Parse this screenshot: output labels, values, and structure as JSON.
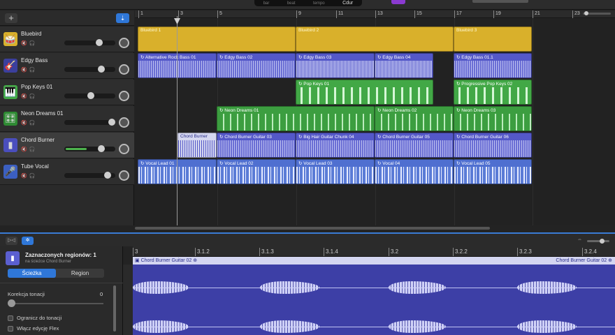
{
  "toolbar": {
    "lcd_items": [
      "bar",
      "beat",
      "tempo",
      "Cdur"
    ]
  },
  "tracks_header": {
    "add_label": "+",
    "smart_icon": "filter-icon"
  },
  "ruler": {
    "bars": [
      "1",
      "3",
      "5",
      "9",
      "11",
      "13",
      "15",
      "17",
      "19",
      "21",
      "23"
    ]
  },
  "tracks": [
    {
      "name": "Bluebird",
      "icon": "drum-icon",
      "icon_glyph": "🥁",
      "icon_color": "#d9b02b"
    },
    {
      "name": "Edgy Bass",
      "icon": "bass-guitar-icon",
      "icon_glyph": "🎸",
      "icon_color": "#5458c8"
    },
    {
      "name": "Pop Keys 01",
      "icon": "keyboard-icon",
      "icon_glyph": "🎹",
      "icon_color": "#42a846"
    },
    {
      "name": "Neon Dreams 01",
      "icon": "synth-icon",
      "icon_glyph": "🎛",
      "icon_color": "#42a846"
    },
    {
      "name": "Chord Burner",
      "icon": "amp-icon",
      "icon_glyph": "▮",
      "icon_color": "#5458c8"
    },
    {
      "name": "Tube Vocal",
      "icon": "microphone-icon",
      "icon_glyph": "🎤",
      "icon_color": "#4f6fd0"
    }
  ],
  "regions": {
    "bluebird": [
      "Bluebird 1",
      "Bluebird 2",
      "Bluebird 3"
    ],
    "bass": [
      "Alternative Rock Bass 01",
      "Edgy Bass 02",
      "Edgy Bass 03",
      "Edgy Bass 04",
      "Edgy Bass 01.1"
    ],
    "keys": [
      "Pop Keys 01",
      "Progressive Pop Keys 02"
    ],
    "neon": [
      "Neon Dreams 01",
      "Neon Dreams 02",
      "Neon Dreams 03"
    ],
    "chord": [
      "Chord Burner",
      "Chord Burner Guitar 03",
      "Big Hair Guitar Chunk 04",
      "Chord Burner Guitar 05",
      "Chord Burner Guitar 06"
    ],
    "vocal": [
      "Vocal Lead 01",
      "Vocal Lead 02",
      "Vocal Lead 03",
      "Vocal 04",
      "Vocal Lead 05"
    ]
  },
  "editor": {
    "selected_title": "Zaznaczonych regionów: 1",
    "selected_sub": "na ścieżce Chord Burner",
    "tab_track": "Ścieżka",
    "tab_region": "Region",
    "pitch_label": "Korekcja tonacji",
    "pitch_value": "0",
    "limit_label": "Ogranicz do tonacji",
    "flex_label": "Włącz edycję Flex",
    "ruler_ticks": [
      "3",
      "3.1.2",
      "3.1.3",
      "3.1.4",
      "3.2",
      "3.2.2",
      "3.2.3",
      "3.2.4"
    ],
    "region_left": "Chord Burner Guitar 02",
    "region_right": "Chord Burner Guitar 02",
    "zoom_icon": "⇔"
  },
  "colors": {
    "accent_blue": "#2f77d8",
    "drums": "#d9b02b",
    "guitar": "#5458c8",
    "keys": "#42a846",
    "vocal": "#4f6fd0"
  }
}
